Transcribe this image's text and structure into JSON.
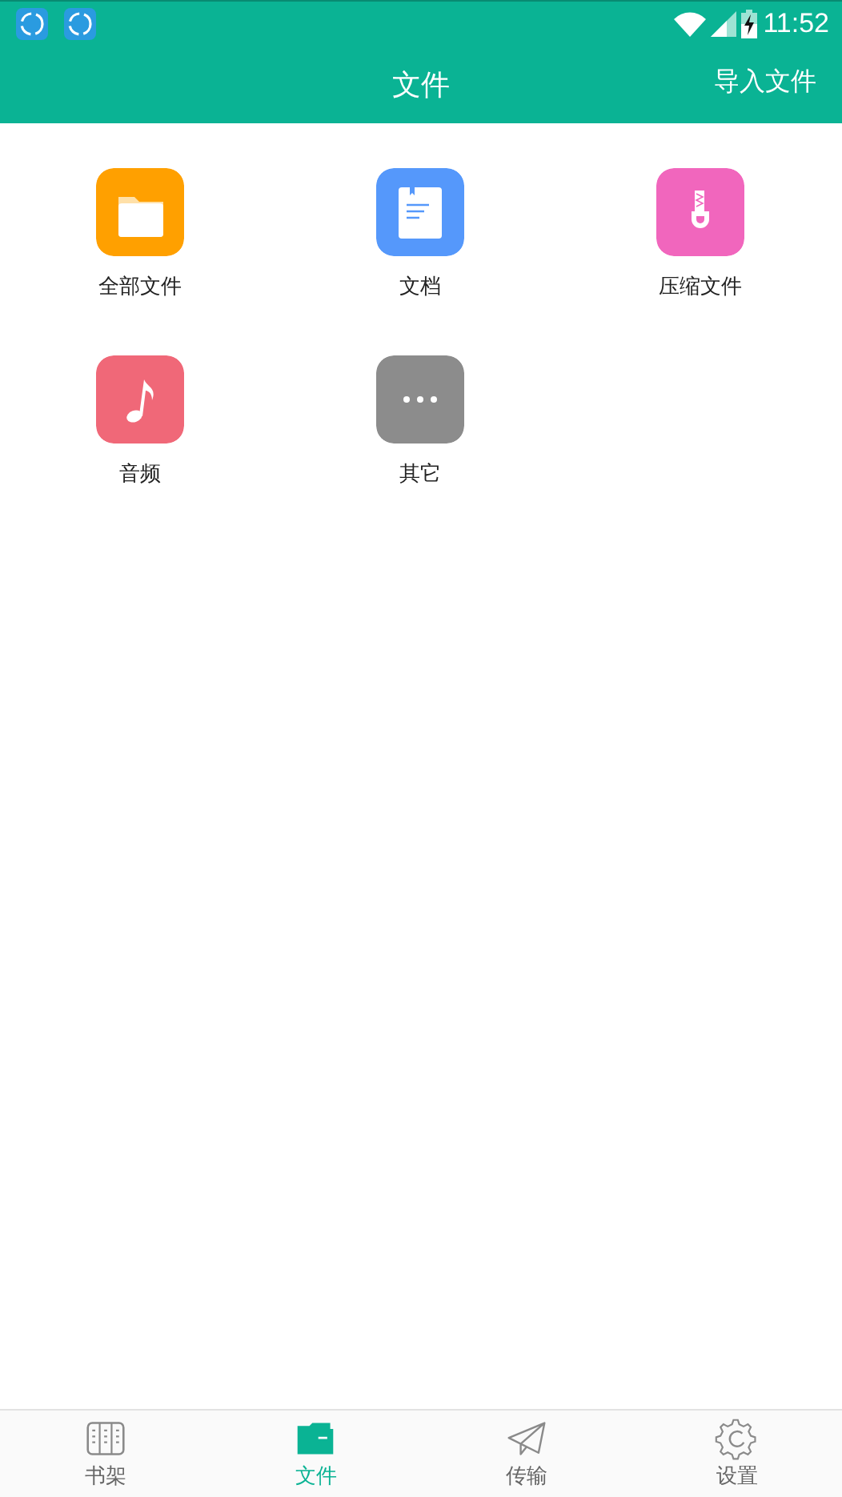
{
  "status_bar": {
    "notifications": [
      {
        "kind": "app"
      },
      {
        "kind": "app"
      }
    ],
    "time": "11:52"
  },
  "header": {
    "title": "文件",
    "action": "导入文件"
  },
  "categories": [
    {
      "kind": "folder",
      "label": "全部文件",
      "color": "#ffa000"
    },
    {
      "kind": "document",
      "label": "文档",
      "color": "#5598fb"
    },
    {
      "kind": "archive",
      "label": "压缩文件",
      "color": "#f166bd"
    },
    {
      "kind": "music",
      "label": "音频",
      "color": "#f06878"
    },
    {
      "kind": "more",
      "label": "其它",
      "color": "#8c8c8c"
    }
  ],
  "nav": [
    {
      "kind": "shelf",
      "label": "书架",
      "selected": false
    },
    {
      "kind": "folder",
      "label": "文件",
      "selected": true
    },
    {
      "kind": "send",
      "label": "传输",
      "selected": false
    },
    {
      "kind": "gear",
      "label": "设置",
      "selected": false
    }
  ]
}
